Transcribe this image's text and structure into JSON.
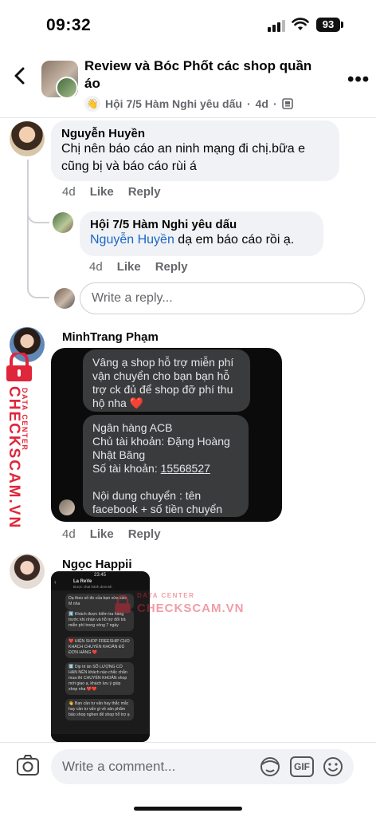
{
  "status_bar": {
    "time": "09:32",
    "battery": "93"
  },
  "header": {
    "title": "Review và Bóc Phốt các shop quần áo",
    "subgroup": "Hội 7/5 Hàm Nghi yêu dấu",
    "separator": "·",
    "time": "4d"
  },
  "comments": [
    {
      "author": "Nguyễn Huyền",
      "text": "Chị nên báo cáo an ninh mạng đi chị.bữa e cũng bị và báo cáo rùi á",
      "time": "4d",
      "like": "Like",
      "reply": "Reply"
    },
    {
      "author": "Hội 7/5 Hàm Nghi yêu dấu",
      "mention": "Nguyễn Huyền",
      "text": " dạ em báo cáo rồi ạ.",
      "time": "4d",
      "like": "Like",
      "reply": "Reply"
    },
    {
      "author": "MinhTrang Phạm",
      "time": "4d",
      "like": "Like",
      "reply": "Reply",
      "screenshot": {
        "msg1": "Vâng ạ shop hỗ trợ miễn phí vận chuyển cho bạn bạn hỗ trợ ck đủ để shop đỡ phí thu hộ nha ❤️",
        "bank_line": "Ngân hàng ACB",
        "owner_line": "Chủ tài khoản: Đặng Hoàng Nhật Băng",
        "account_label": "Số tài khoản: ",
        "account_number": "15568527",
        "content_line": "Nội dung chuyển : tên facebook + số tiền chuyển"
      }
    },
    {
      "author": "Ngọc Happii",
      "screenshot": {
        "time": "23:45",
        "shop_name": "La ReVe",
        "shop_status": "Được chat hành dennsh",
        "m1": "Dạ theo số đo của bạn vừa size M nha",
        "m2": "1️⃣ Khách được kiểm tra hàng trước khi nhận và hỗ trợ đổi trả miễn phí trong vòng 7 ngày",
        "m3": "❤️ HIỆN SHOP FREESHIP CHO KHÁCH CHUYỂN KHOẢN ĐỦ ĐƠN HÀNG ❤️",
        "m4": "2️⃣ Dịp tri ân SỐ LƯỢNG CÓ HẠN NÊN khách nào chắc chắn mua thì CHUYỂN KHOẢN shop mới giao ạ, khách lưu ý giúp shop nha ❤️❤️",
        "m5": "👋 Bạn cần tư vấn hay thắc mắc hay cần tư vấn gì về sản phẩm bảo shop nghen để shop hỗ trợ ạ"
      }
    }
  ],
  "reply_input": {
    "placeholder": "Write a reply..."
  },
  "watermark": {
    "label": "DATA CENTER",
    "brand": "CHECKSCAM.VN"
  },
  "comment_bar": {
    "placeholder": "Write a comment...",
    "gif": "GIF"
  }
}
